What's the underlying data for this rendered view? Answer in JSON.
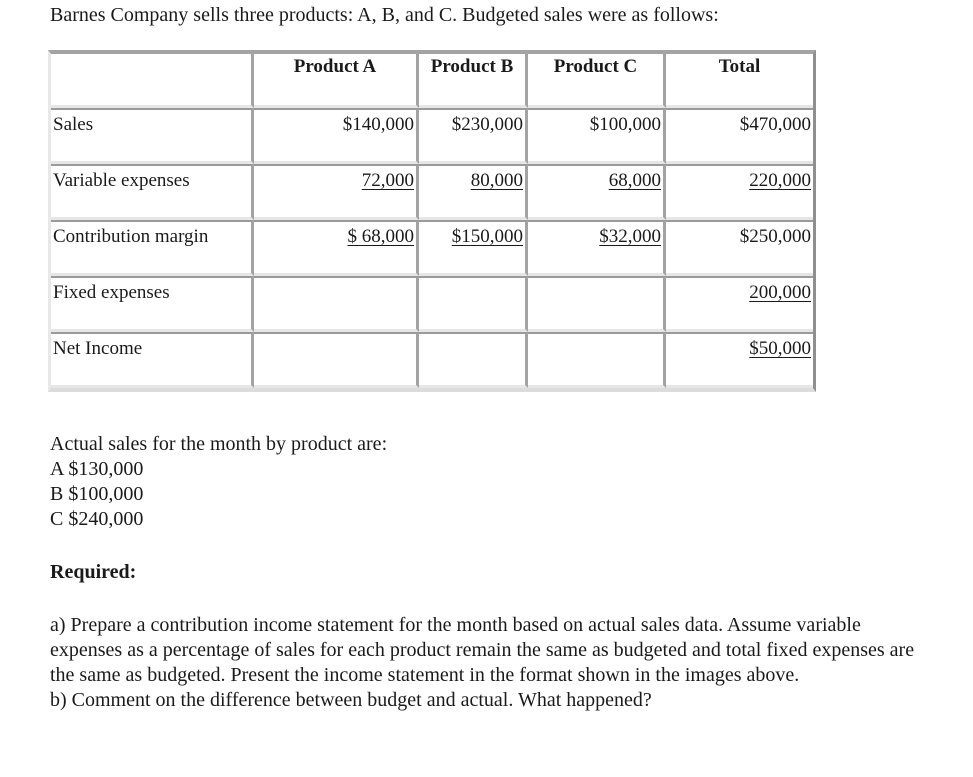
{
  "intro": "Barnes Company sells three products: A, B, and C.  Budgeted sales were as follows:",
  "table": {
    "headers": [
      "",
      "Product A",
      "Product B",
      "Product C",
      "Total"
    ],
    "rows": [
      {
        "label": "Sales",
        "values": [
          "$140,000",
          "$230,000",
          "$100,000",
          "$470,000"
        ],
        "underlined": [
          false,
          false,
          false,
          false
        ]
      },
      {
        "label": "Variable expenses",
        "values": [
          "72,000",
          "80,000",
          "68,000",
          "220,000"
        ],
        "underlined": [
          true,
          true,
          true,
          true
        ]
      },
      {
        "label": "Contribution margin",
        "values": [
          "$ 68,000",
          "$150,000",
          "$32,000",
          "$250,000"
        ],
        "underlined": [
          true,
          true,
          true,
          false
        ]
      },
      {
        "label": "Fixed expenses",
        "values": [
          "",
          "",
          "",
          "200,000"
        ],
        "underlined": [
          false,
          false,
          false,
          true
        ]
      },
      {
        "label": "Net Income",
        "values": [
          "",
          "",
          "",
          "$50,000"
        ],
        "underlined": [
          false,
          false,
          false,
          true
        ]
      }
    ]
  },
  "actual": {
    "heading": "Actual sales for the month by product are:",
    "items": [
      "A $130,000",
      "B $100,000",
      "C $240,000"
    ]
  },
  "required": {
    "heading": "Required:",
    "part_a": "a) Prepare a contribution income statement for the month based on actual sales data. Assume variable expenses as a percentage of sales for each product remain the same as budgeted and total fixed expenses are the same as budgeted. Present the income statement in the format shown in the images above.",
    "part_b": "b) Comment on the difference between budget and actual.  What happened?"
  }
}
